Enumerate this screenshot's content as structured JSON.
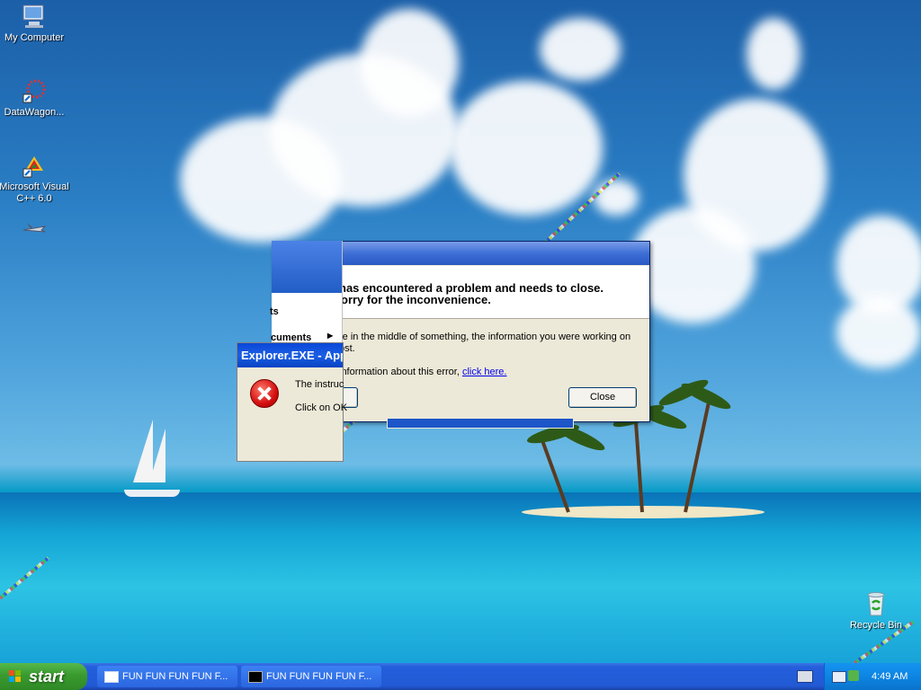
{
  "desktop_icons": [
    {
      "id": "my-computer",
      "label": "My Computer"
    },
    {
      "id": "datawagon",
      "label": "DataWagon..."
    },
    {
      "id": "msvc",
      "label": "Microsoft Visual C++ 6.0"
    },
    {
      "id": "recycle-bin",
      "label": "Recycle Bin"
    }
  ],
  "error_dialog": {
    "headline": "has encountered a problem and needs to close.",
    "apology": "orry for the inconvenience.",
    "body_line1": "re in the middle of something, the information you were working on",
    "body_line2": "ost.",
    "more_info_text": "information about this error,",
    "link_text": "click here.",
    "close_button": "Close"
  },
  "start_menu": {
    "item1": "ts",
    "item2": "cuments"
  },
  "app_error": {
    "title": "Explorer.EXE - App",
    "line1": "The instruc",
    "line2": "Click on OK"
  },
  "taskbar": {
    "start_label": "start",
    "tasks": [
      {
        "label": "FUN FUN FUN FUN F..."
      },
      {
        "label": "FUN FUN FUN FUN F..."
      }
    ],
    "clock": "4:49 AM"
  },
  "colors": {
    "taskbar_blue": "#245edb",
    "start_green": "#3a9a2f",
    "title_blue": "#0a47d8",
    "dialog_bg": "#ece9d8"
  }
}
